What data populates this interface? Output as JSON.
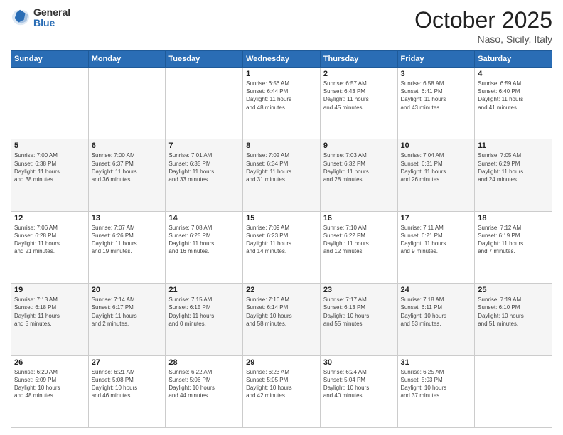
{
  "logo": {
    "general": "General",
    "blue": "Blue"
  },
  "header": {
    "month": "October 2025",
    "location": "Naso, Sicily, Italy"
  },
  "weekdays": [
    "Sunday",
    "Monday",
    "Tuesday",
    "Wednesday",
    "Thursday",
    "Friday",
    "Saturday"
  ],
  "weeks": [
    [
      {
        "day": "",
        "info": ""
      },
      {
        "day": "",
        "info": ""
      },
      {
        "day": "",
        "info": ""
      },
      {
        "day": "1",
        "info": "Sunrise: 6:56 AM\nSunset: 6:44 PM\nDaylight: 11 hours\nand 48 minutes."
      },
      {
        "day": "2",
        "info": "Sunrise: 6:57 AM\nSunset: 6:43 PM\nDaylight: 11 hours\nand 45 minutes."
      },
      {
        "day": "3",
        "info": "Sunrise: 6:58 AM\nSunset: 6:41 PM\nDaylight: 11 hours\nand 43 minutes."
      },
      {
        "day": "4",
        "info": "Sunrise: 6:59 AM\nSunset: 6:40 PM\nDaylight: 11 hours\nand 41 minutes."
      }
    ],
    [
      {
        "day": "5",
        "info": "Sunrise: 7:00 AM\nSunset: 6:38 PM\nDaylight: 11 hours\nand 38 minutes."
      },
      {
        "day": "6",
        "info": "Sunrise: 7:00 AM\nSunset: 6:37 PM\nDaylight: 11 hours\nand 36 minutes."
      },
      {
        "day": "7",
        "info": "Sunrise: 7:01 AM\nSunset: 6:35 PM\nDaylight: 11 hours\nand 33 minutes."
      },
      {
        "day": "8",
        "info": "Sunrise: 7:02 AM\nSunset: 6:34 PM\nDaylight: 11 hours\nand 31 minutes."
      },
      {
        "day": "9",
        "info": "Sunrise: 7:03 AM\nSunset: 6:32 PM\nDaylight: 11 hours\nand 28 minutes."
      },
      {
        "day": "10",
        "info": "Sunrise: 7:04 AM\nSunset: 6:31 PM\nDaylight: 11 hours\nand 26 minutes."
      },
      {
        "day": "11",
        "info": "Sunrise: 7:05 AM\nSunset: 6:29 PM\nDaylight: 11 hours\nand 24 minutes."
      }
    ],
    [
      {
        "day": "12",
        "info": "Sunrise: 7:06 AM\nSunset: 6:28 PM\nDaylight: 11 hours\nand 21 minutes."
      },
      {
        "day": "13",
        "info": "Sunrise: 7:07 AM\nSunset: 6:26 PM\nDaylight: 11 hours\nand 19 minutes."
      },
      {
        "day": "14",
        "info": "Sunrise: 7:08 AM\nSunset: 6:25 PM\nDaylight: 11 hours\nand 16 minutes."
      },
      {
        "day": "15",
        "info": "Sunrise: 7:09 AM\nSunset: 6:23 PM\nDaylight: 11 hours\nand 14 minutes."
      },
      {
        "day": "16",
        "info": "Sunrise: 7:10 AM\nSunset: 6:22 PM\nDaylight: 11 hours\nand 12 minutes."
      },
      {
        "day": "17",
        "info": "Sunrise: 7:11 AM\nSunset: 6:21 PM\nDaylight: 11 hours\nand 9 minutes."
      },
      {
        "day": "18",
        "info": "Sunrise: 7:12 AM\nSunset: 6:19 PM\nDaylight: 11 hours\nand 7 minutes."
      }
    ],
    [
      {
        "day": "19",
        "info": "Sunrise: 7:13 AM\nSunset: 6:18 PM\nDaylight: 11 hours\nand 5 minutes."
      },
      {
        "day": "20",
        "info": "Sunrise: 7:14 AM\nSunset: 6:17 PM\nDaylight: 11 hours\nand 2 minutes."
      },
      {
        "day": "21",
        "info": "Sunrise: 7:15 AM\nSunset: 6:15 PM\nDaylight: 11 hours\nand 0 minutes."
      },
      {
        "day": "22",
        "info": "Sunrise: 7:16 AM\nSunset: 6:14 PM\nDaylight: 10 hours\nand 58 minutes."
      },
      {
        "day": "23",
        "info": "Sunrise: 7:17 AM\nSunset: 6:13 PM\nDaylight: 10 hours\nand 55 minutes."
      },
      {
        "day": "24",
        "info": "Sunrise: 7:18 AM\nSunset: 6:11 PM\nDaylight: 10 hours\nand 53 minutes."
      },
      {
        "day": "25",
        "info": "Sunrise: 7:19 AM\nSunset: 6:10 PM\nDaylight: 10 hours\nand 51 minutes."
      }
    ],
    [
      {
        "day": "26",
        "info": "Sunrise: 6:20 AM\nSunset: 5:09 PM\nDaylight: 10 hours\nand 48 minutes."
      },
      {
        "day": "27",
        "info": "Sunrise: 6:21 AM\nSunset: 5:08 PM\nDaylight: 10 hours\nand 46 minutes."
      },
      {
        "day": "28",
        "info": "Sunrise: 6:22 AM\nSunset: 5:06 PM\nDaylight: 10 hours\nand 44 minutes."
      },
      {
        "day": "29",
        "info": "Sunrise: 6:23 AM\nSunset: 5:05 PM\nDaylight: 10 hours\nand 42 minutes."
      },
      {
        "day": "30",
        "info": "Sunrise: 6:24 AM\nSunset: 5:04 PM\nDaylight: 10 hours\nand 40 minutes."
      },
      {
        "day": "31",
        "info": "Sunrise: 6:25 AM\nSunset: 5:03 PM\nDaylight: 10 hours\nand 37 minutes."
      },
      {
        "day": "",
        "info": ""
      }
    ]
  ]
}
